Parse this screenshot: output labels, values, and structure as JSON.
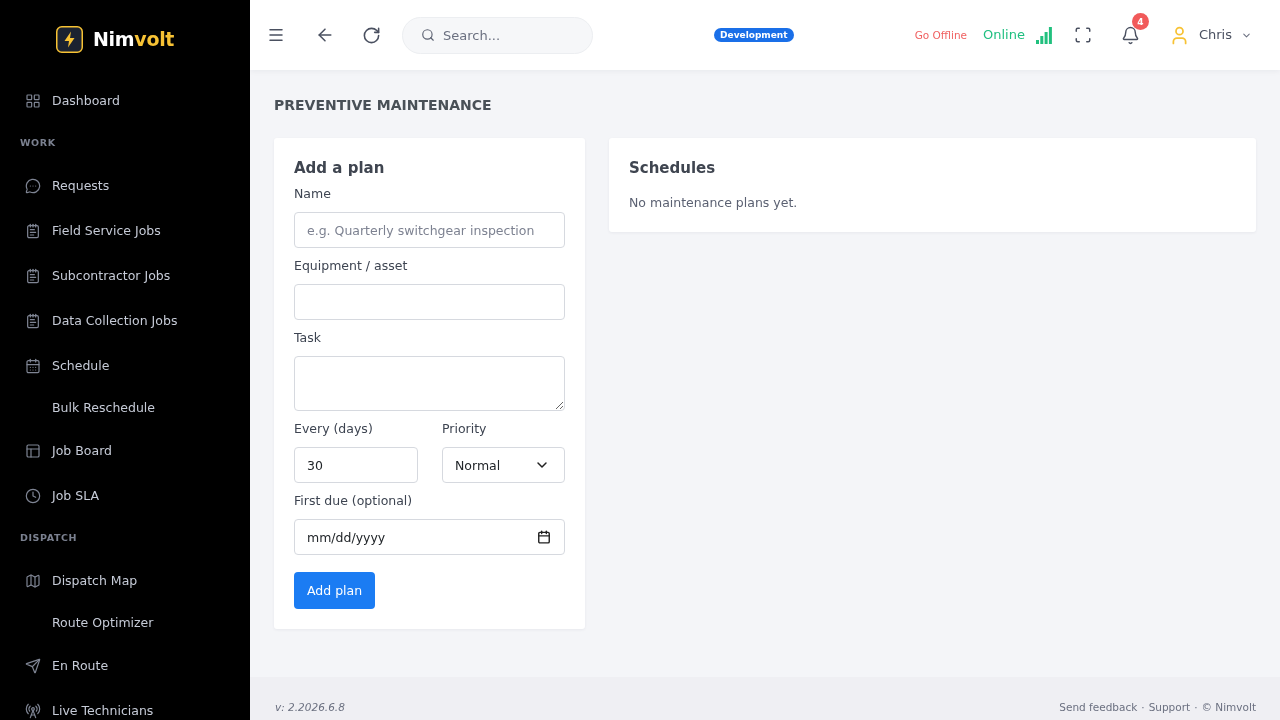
{
  "sidebar": {
    "logo": {
      "text": "Nim",
      "accent": "volt"
    },
    "sections": [
      {
        "items": [
          {
            "kind": "link",
            "label": "Dashboard"
          }
        ]
      },
      {
        "heading": "WORK",
        "items": [
          {
            "kind": "link",
            "label": "Requests"
          },
          {
            "kind": "link",
            "label": "Field Service Jobs"
          },
          {
            "kind": "link",
            "label": "Subcontractor Jobs"
          },
          {
            "kind": "link",
            "label": "Data Collection Jobs"
          },
          {
            "kind": "link",
            "label": "Schedule"
          },
          {
            "kind": "sublink",
            "label": "Bulk Reschedule"
          },
          {
            "kind": "link",
            "label": "Job Board"
          },
          {
            "kind": "link",
            "label": "Job SLA"
          }
        ]
      },
      {
        "heading": "DISPATCH",
        "items": [
          {
            "kind": "link",
            "label": "Dispatch Map"
          },
          {
            "kind": "sublink",
            "label": "Route Optimizer"
          },
          {
            "kind": "link",
            "label": "En Route"
          },
          {
            "kind": "link",
            "label": "Live Technicians"
          }
        ]
      }
    ]
  },
  "topbar": {
    "search": {
      "placeholder": "Search..."
    },
    "environment_badge": "Development",
    "go_offline": "Go Offline",
    "connection_status": "Online",
    "notifications": {
      "count": "4"
    },
    "user": {
      "name": "Chris"
    }
  },
  "page": {
    "title": "PREVENTIVE MAINTENANCE",
    "plan_form": {
      "title": "Add a plan",
      "fields": [
        {
          "kind": "text",
          "label": "Name",
          "placeholder": "e.g. Quarterly switchgear inspection"
        },
        {
          "kind": "text",
          "label": "Equipment / asset"
        },
        {
          "kind": "textarea",
          "label": "Task"
        },
        {
          "kind": "row",
          "fields": [
            {
              "kind": "number",
              "label": "Every (days)",
              "value": "30"
            },
            {
              "kind": "select",
              "label": "Priority",
              "value": "Normal"
            }
          ]
        },
        {
          "kind": "date",
          "label": "First due (optional)",
          "placeholder": "mm/dd/yyyy"
        }
      ],
      "submit": "Add plan"
    },
    "schedules": {
      "title": "Schedules",
      "empty_message": "No maintenance plans yet."
    }
  },
  "footer": {
    "version": "v: 2.2026.6.8",
    "links": [
      "Send feedback",
      "Support"
    ],
    "separators": [
      "·",
      "·"
    ],
    "copyright": "© Nimvolt"
  }
}
